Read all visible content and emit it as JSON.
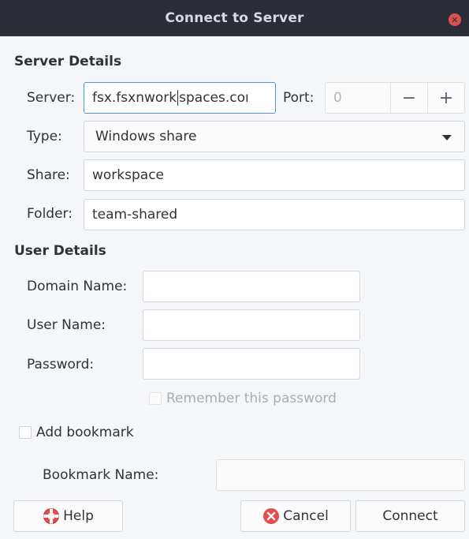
{
  "window": {
    "title": "Connect to Server"
  },
  "server_details": {
    "title": "Server Details",
    "server_label": "Server:",
    "server_value_before_caret": "fsx.fsxnwork",
    "server_value_after_caret": "spaces.coı",
    "port_label": "Port:",
    "port_value": "0",
    "minus": "−",
    "plus": "+",
    "type_label": "Type:",
    "type_value": "Windows share",
    "share_label": "Share:",
    "share_value": "workspace",
    "folder_label": "Folder:",
    "folder_value": "team-shared"
  },
  "user_details": {
    "title": "User Details",
    "domain_label": "Domain Name:",
    "domain_value": "",
    "username_label": "User Name:",
    "username_value": "",
    "password_label": "Password:",
    "password_value": "",
    "remember_label": "Remember this password"
  },
  "bookmark": {
    "add_label": "Add bookmark",
    "name_label": "Bookmark Name:",
    "name_value": ""
  },
  "buttons": {
    "help": "Help",
    "cancel": "Cancel",
    "connect": "Connect"
  },
  "colors": {
    "titlebar": "#2b2e37",
    "close": "#e14e4e",
    "focus": "#5294e2"
  }
}
